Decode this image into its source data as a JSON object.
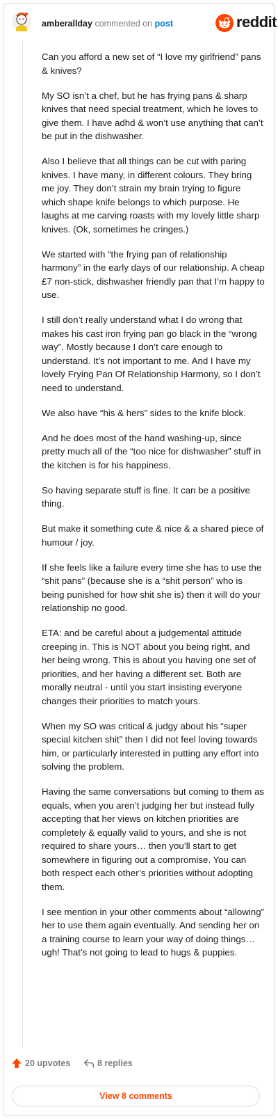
{
  "header": {
    "username": "amberallday",
    "verb": "commented on",
    "post_link": "post",
    "brand": "reddit"
  },
  "comment": {
    "paragraphs": [
      "Can you afford a new set of “I love my girlfriend” pans & knives?",
      "My SO isn’t a chef, but he has frying pans & sharp knives that need special treatment, which he loves to give them. I have adhd & won’t use anything that can’t be put in the dishwasher.",
      "Also I believe that all things can be cut with paring knives. I have many, in different colours. They bring me joy. They don’t strain my brain trying to figure which shape knife belongs to which purpose. He laughs at me carving roasts with my lovely little sharp knives. (Ok, sometimes he cringes.)",
      "We started with “the frying pan of relationship harmony” in the early days of our relationship. A cheap £7 non-stick, dishwasher friendly pan that I’m happy to use.",
      "I still don’t really understand what I do wrong that makes his cast iron frying pan go black in the “wrong way”. Mostly because I don’t care enough to understand. It’s not important to me. And I have my lovely Frying Pan Of Relationship Harmony, so I don’t need to understand.",
      "We also have “his & hers” sides to the knife block.",
      "And he does most of the hand washing-up, since pretty much all of the “too nice for dishwasher” stuff in the kitchen is for his happiness.",
      "So having separate stuff is fine. It can be a positive thing.",
      "But make it something cute & nice & a shared piece of humour / joy.",
      "If she feels like a failure every time she has to use the “shit pans” (because she is a “shit person” who is being punished for how shit she is) then it will do your relationship no good.",
      "ETA: and be careful about a judgemental attitude creeping in. This is NOT about you being right, and her being wrong. This is about you having one set of priorities, and her having a different set. Both are morally neutral - until you start insisting everyone changes their priorities to match yours.",
      "When my SO was critical & judgy about his “super special kitchen shit” then I did not feel loving towards him, or particularly interested in putting any effort into solving the problem.",
      "Having the same conversations but coming to them as equals, when you aren’t judging her but instead fully accepting that her views on kitchen priorities are completely & equally valid to yours, and she is not required to share yours… then you’ll start to get somewhere in figuring out a compromise. You can both respect each other’s priorities without adopting them.",
      "I see mention in your other comments about “allowing” her to use them again eventually. And sending her on a training course to learn your way of doing things… ugh! That’s not going to lead to hugs & puppies."
    ]
  },
  "footer": {
    "upvotes_label": "20 upvotes",
    "replies_label": "8 replies",
    "view_button": "View 8 comments"
  },
  "icons": {
    "upvote": "upvote-arrow-icon",
    "reply": "reply-arrow-icon",
    "brand": "reddit-snoo-icon",
    "avatar": "user-avatar"
  },
  "colors": {
    "brand": "#ff4500",
    "link": "#0079d3",
    "muted": "#7c7c7c",
    "text": "#1a1a1b"
  }
}
